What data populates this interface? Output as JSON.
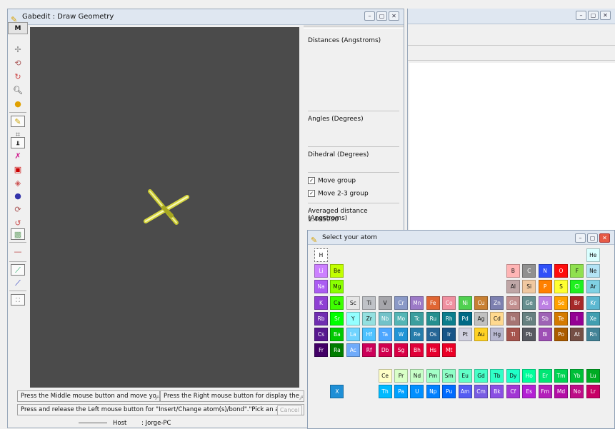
{
  "gabedit": {
    "title": "Gabedit : Draw Geometry",
    "mode_button": "M",
    "info": {
      "distances": "Distances (Angstroms)",
      "angles": "Angles (Degrees)",
      "dihedral": "Dihedral (Degrees)",
      "move_group": "Move group",
      "move_23_group": "Move 2-3 group",
      "averaged": "Averaged distance (Angstroms)",
      "averaged_value": "1.485000"
    },
    "status": {
      "middle": "Press the Middle mouse button and move yo...",
      "right": "Press the Right mouse button for display the ...",
      "left": "Press and release the Left mouse button for \"Insert/Change atom(s)/bond\".\"Pick an ato...",
      "cancel": "Cancel"
    },
    "host_label": "Host",
    "host_value": ": Jorge-PC"
  },
  "atom_window": {
    "title": "Select your atom",
    "colors": {
      "accent_bg": "#4b4b4b"
    },
    "elements": [
      [
        "H",
        0,
        0,
        "#ffffff"
      ],
      [
        "He",
        17,
        0,
        "#d9ffff"
      ],
      [
        "Li",
        0,
        1,
        "#cc80ff"
      ],
      [
        "Be",
        1,
        1,
        "#c2ff00"
      ],
      [
        "B",
        12,
        1,
        "#ffb5b5"
      ],
      [
        "C",
        13,
        1,
        "#909090"
      ],
      [
        "N",
        14,
        1,
        "#3050f8"
      ],
      [
        "O",
        15,
        1,
        "#ff0d0d"
      ],
      [
        "F",
        16,
        1,
        "#90e050"
      ],
      [
        "Ne",
        17,
        1,
        "#b3e3f5"
      ],
      [
        "Na",
        0,
        2,
        "#ab5cf2"
      ],
      [
        "Mg",
        1,
        2,
        "#8aff00"
      ],
      [
        "Al",
        12,
        2,
        "#bfa6a6"
      ],
      [
        "Si",
        13,
        2,
        "#f0c8a0"
      ],
      [
        "P",
        14,
        2,
        "#ff8000"
      ],
      [
        "S",
        15,
        2,
        "#ffff30"
      ],
      [
        "Cl",
        16,
        2,
        "#1ff01f"
      ],
      [
        "Ar",
        17,
        2,
        "#80d1e3"
      ],
      [
        "K",
        0,
        3,
        "#8f40d4"
      ],
      [
        "Ca",
        1,
        3,
        "#3dff00"
      ],
      [
        "Sc",
        2,
        3,
        "#e6e6e6"
      ],
      [
        "Ti",
        3,
        3,
        "#bfc2c7"
      ],
      [
        "V",
        4,
        3,
        "#a6a6ab"
      ],
      [
        "Cr",
        5,
        3,
        "#8a99c7"
      ],
      [
        "Mn",
        6,
        3,
        "#9c7ac7"
      ],
      [
        "Fe",
        7,
        3,
        "#e06633"
      ],
      [
        "Co",
        8,
        3,
        "#f090a0"
      ],
      [
        "Ni",
        9,
        3,
        "#50d050"
      ],
      [
        "Cu",
        10,
        3,
        "#c88033"
      ],
      [
        "Zn",
        11,
        3,
        "#7d80b0"
      ],
      [
        "Ga",
        12,
        3,
        "#c28f8f"
      ],
      [
        "Ge",
        13,
        3,
        "#668f8f"
      ],
      [
        "As",
        14,
        3,
        "#bd80e3"
      ],
      [
        "Se",
        15,
        3,
        "#ffa100"
      ],
      [
        "Br",
        16,
        3,
        "#a62929"
      ],
      [
        "Kr",
        17,
        3,
        "#5cb8d1"
      ],
      [
        "Rb",
        0,
        4,
        "#702eb0"
      ],
      [
        "Sr",
        1,
        4,
        "#00ff00"
      ],
      [
        "Y",
        2,
        4,
        "#94ffff"
      ],
      [
        "Zr",
        3,
        4,
        "#94e0e0"
      ],
      [
        "Nb",
        4,
        4,
        "#73c2c9"
      ],
      [
        "Mo",
        5,
        4,
        "#54b5b5"
      ],
      [
        "Tc",
        6,
        4,
        "#3b9e9e"
      ],
      [
        "Ru",
        7,
        4,
        "#248f8f"
      ],
      [
        "Rh",
        8,
        4,
        "#0a7d8c"
      ],
      [
        "Pd",
        9,
        4,
        "#006985"
      ],
      [
        "Ag",
        10,
        4,
        "#c0c0c0"
      ],
      [
        "Cd",
        11,
        4,
        "#ffd98f"
      ],
      [
        "In",
        12,
        4,
        "#a67573"
      ],
      [
        "Sn",
        13,
        4,
        "#668080"
      ],
      [
        "Sb",
        14,
        4,
        "#9e63b5"
      ],
      [
        "Te",
        15,
        4,
        "#d47a00"
      ],
      [
        "I",
        16,
        4,
        "#940094"
      ],
      [
        "Xe",
        17,
        4,
        "#429eb0"
      ],
      [
        "Cs",
        0,
        5,
        "#57178f"
      ],
      [
        "Ba",
        1,
        5,
        "#00c900"
      ],
      [
        "La",
        2,
        5,
        "#70d4ff"
      ],
      [
        "Hf",
        3,
        5,
        "#4dc2ff"
      ],
      [
        "Ta",
        4,
        5,
        "#4da6ff"
      ],
      [
        "W",
        5,
        5,
        "#2194d6"
      ],
      [
        "Re",
        6,
        5,
        "#267dab"
      ],
      [
        "Os",
        7,
        5,
        "#266696"
      ],
      [
        "Ir",
        8,
        5,
        "#175487"
      ],
      [
        "Pt",
        9,
        5,
        "#d0d0e0"
      ],
      [
        "Au",
        10,
        5,
        "#ffd123"
      ],
      [
        "Hg",
        11,
        5,
        "#b8b8d0"
      ],
      [
        "Tl",
        12,
        5,
        "#a6544d"
      ],
      [
        "Pb",
        13,
        5,
        "#575961"
      ],
      [
        "Bi",
        14,
        5,
        "#9e4fb5"
      ],
      [
        "Po",
        15,
        5,
        "#ab5c00"
      ],
      [
        "At",
        16,
        5,
        "#754f45"
      ],
      [
        "Rn",
        17,
        5,
        "#428296"
      ],
      [
        "Fr",
        0,
        6,
        "#420066"
      ],
      [
        "Ra",
        1,
        6,
        "#007d00"
      ],
      [
        "Ac",
        2,
        6,
        "#70abfa"
      ],
      [
        "Rf",
        3,
        6,
        "#cc0059"
      ],
      [
        "Db",
        4,
        6,
        "#d1004f"
      ],
      [
        "Sg",
        5,
        6,
        "#d90045"
      ],
      [
        "Bh",
        6,
        6,
        "#e00038"
      ],
      [
        "Hs",
        7,
        6,
        "#e6002e"
      ],
      [
        "Mt",
        8,
        6,
        "#eb0026"
      ],
      [
        "Ce",
        4,
        7.6,
        "#ffffc7"
      ],
      [
        "Pr",
        5,
        7.6,
        "#d9ffc7"
      ],
      [
        "Nd",
        6,
        7.6,
        "#c7ffc7"
      ],
      [
        "Pm",
        7,
        7.6,
        "#a3ffc7"
      ],
      [
        "Sm",
        8,
        7.6,
        "#8fffc7"
      ],
      [
        "Eu",
        9,
        7.6,
        "#61ffc7"
      ],
      [
        "Gd",
        10,
        7.6,
        "#45ffc7"
      ],
      [
        "Tb",
        11,
        7.6,
        "#30ffc7"
      ],
      [
        "Dy",
        12,
        7.6,
        "#1fffc7"
      ],
      [
        "Ho",
        13,
        7.6,
        "#00ff9c"
      ],
      [
        "Er",
        14,
        7.6,
        "#00e675"
      ],
      [
        "Tm",
        15,
        7.6,
        "#00d452"
      ],
      [
        "Yb",
        16,
        7.6,
        "#00bf38"
      ],
      [
        "Lu",
        17,
        7.6,
        "#00ab24"
      ],
      [
        "X",
        1,
        8.6,
        "#1f8fd6"
      ],
      [
        "Th",
        4,
        8.6,
        "#00baff"
      ],
      [
        "Pa",
        5,
        8.6,
        "#00a1ff"
      ],
      [
        "U",
        6,
        8.6,
        "#008fff"
      ],
      [
        "Np",
        7,
        8.6,
        "#0080ff"
      ],
      [
        "Pu",
        8,
        8.6,
        "#006bff"
      ],
      [
        "Am",
        9,
        8.6,
        "#545cf2"
      ],
      [
        "Cm",
        10,
        8.6,
        "#785ce3"
      ],
      [
        "Bk",
        11,
        8.6,
        "#8a4fe3"
      ],
      [
        "Cf",
        12,
        8.6,
        "#a136d4"
      ],
      [
        "Es",
        13,
        8.6,
        "#b31fd4"
      ],
      [
        "Fm",
        14,
        8.6,
        "#b31fba"
      ],
      [
        "Md",
        15,
        8.6,
        "#b30da6"
      ],
      [
        "No",
        16,
        8.6,
        "#bd0d87"
      ],
      [
        "Lr",
        17,
        8.6,
        "#c70066"
      ]
    ]
  }
}
